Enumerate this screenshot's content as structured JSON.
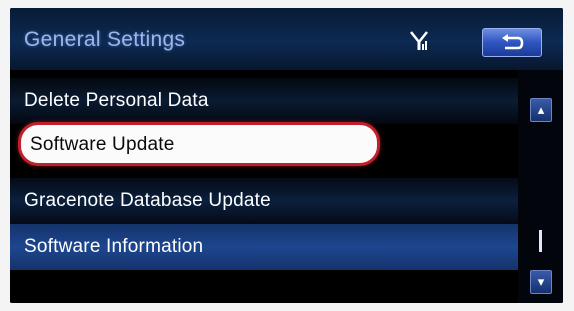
{
  "header": {
    "title": "General Settings",
    "signal_icon": "signal-antenna-icon",
    "back_icon": "return-arrow-icon"
  },
  "menu": {
    "items": [
      {
        "label": "Delete Personal Data",
        "selected": false
      },
      {
        "label": "Software Update",
        "selected": true
      },
      {
        "label": "Gracenote Database Update",
        "selected": false
      },
      {
        "label": "Software Information",
        "selected": false
      }
    ]
  },
  "scrollbar": {
    "up_icon": "scroll-up-icon",
    "down_icon": "scroll-down-icon"
  },
  "colors": {
    "header_bg": "#0d2a52",
    "title_text": "#9bb6ea",
    "highlight_border": "#c0202b",
    "button_blue": "#2f55c0"
  }
}
